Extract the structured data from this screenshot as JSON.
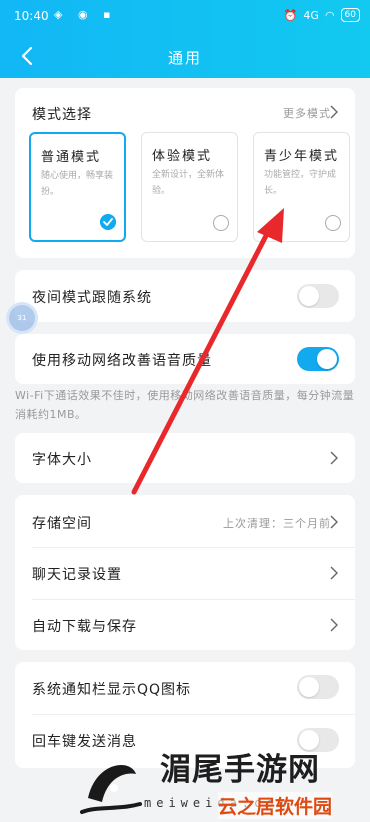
{
  "status_bar": {
    "time": "10:40",
    "battery": "60",
    "network": "4G"
  },
  "header": {
    "title": "通用"
  },
  "mode": {
    "label": "模式选择",
    "more": "更多模式",
    "options": [
      {
        "name": "普通模式",
        "desc": "随心使用，畅享装扮。",
        "selected": true
      },
      {
        "name": "体验模式",
        "desc": "全新设计，全新体验。",
        "selected": false
      },
      {
        "name": "青少年模式",
        "desc": "功能管控，守护成长。",
        "selected": false
      }
    ]
  },
  "night_mode": {
    "label": "夜间模式跟随系统",
    "on": false
  },
  "mobile_network": {
    "label": "使用移动网络改善语音质量",
    "on": true,
    "hint": "Wi-Fi下通话效果不佳时，使用移动网络改善语音质量，每分钟流量消耗约1MB。"
  },
  "font_size": {
    "label": "字体大小"
  },
  "storage": {
    "label": "存储空间",
    "value": "上次清理：三个月前",
    "chat_history": "聊天记录设置",
    "auto_download": "自动下载与保存"
  },
  "notifications": {
    "qq_icon": {
      "label": "系统通知栏显示QQ图标",
      "on": false
    },
    "enter_send": {
      "label": "回车键发送消息",
      "on": false
    }
  },
  "float_ball": {
    "text": "31"
  },
  "watermark": {
    "main": "湄尾手游网",
    "sub": "meiweida.com",
    "site": "云之居软件园"
  },
  "colors": {
    "accent": "#12a9ee",
    "header": "#12b7f5",
    "arrow": "#e8282b"
  }
}
